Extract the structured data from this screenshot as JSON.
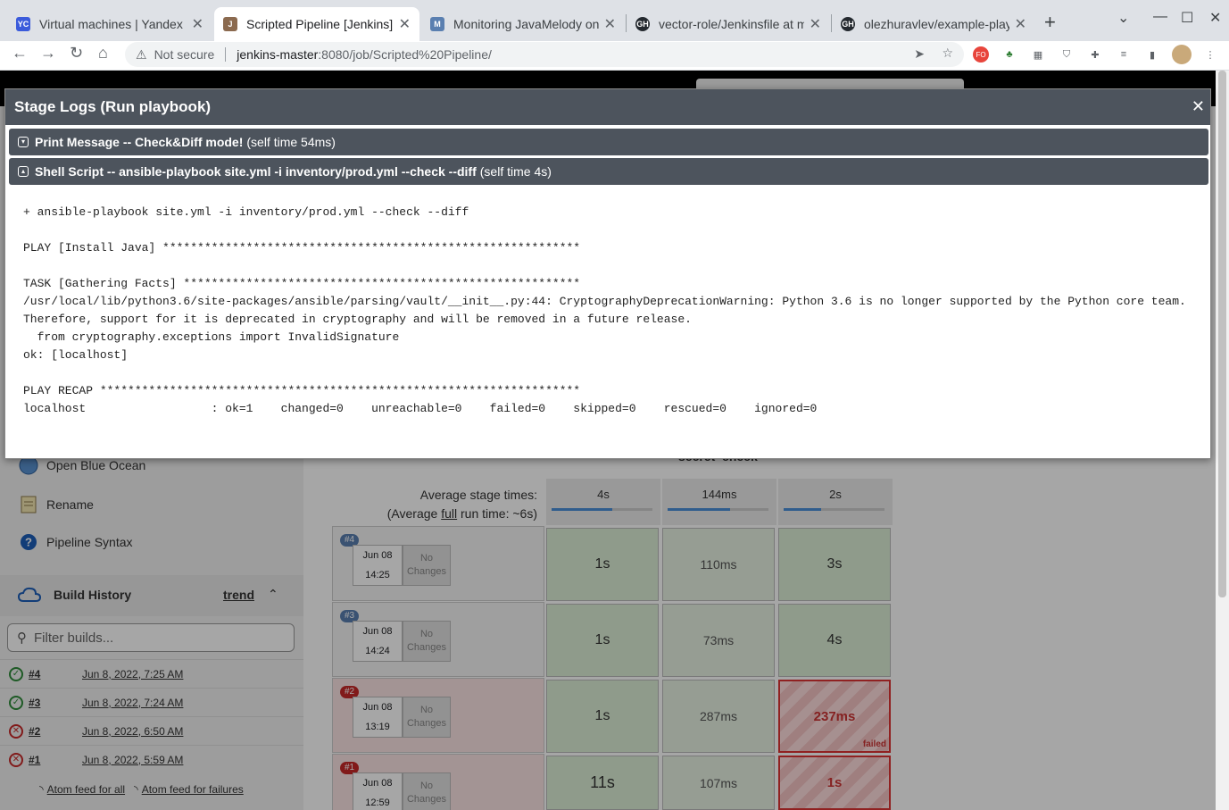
{
  "browser": {
    "tabs": [
      {
        "title": "Virtual machines | Yandex Cl",
        "favicon": "YC",
        "color": "#3b5bdb",
        "active": false
      },
      {
        "title": "Scripted Pipeline [Jenkins]",
        "favicon": "J",
        "color": "#8b6a4f",
        "active": true
      },
      {
        "title": "Monitoring JavaMelody on _je",
        "favicon": "M",
        "color": "#5a7fb0",
        "active": false
      },
      {
        "title": "vector-role/Jenkinsfile at ma",
        "favicon": "GH",
        "color": "#24292f",
        "active": false
      },
      {
        "title": "olezhuravlev/example-playb",
        "favicon": "GH",
        "color": "#24292f",
        "active": false
      }
    ],
    "url_security": "Not secure",
    "url_host": "jenkins-master",
    "url_path": ":8080/job/Scripted%20Pipeline/"
  },
  "modal": {
    "title": "Stage Logs (Run playbook)",
    "close_label": "✕",
    "sections": [
      {
        "label": "Print Message -- Check&Diff mode!",
        "time": "(self time 54ms)"
      },
      {
        "label": "Shell Script -- ansible-playbook site.yml -i inventory/prod.yml --check --diff",
        "time": "(self time 4s)"
      }
    ],
    "console": "+ ansible-playbook site.yml -i inventory/prod.yml --check --diff\n\nPLAY [Install Java] ************************************************************\n\nTASK [Gathering Facts] *********************************************************\n/usr/local/lib/python3.6/site-packages/ansible/parsing/vault/__init__.py:44: CryptographyDeprecationWarning: Python 3.6 is no longer supported by the Python core team.\nTherefore, support for it is deprecated in cryptography and will be removed in a future release.\n  from cryptography.exceptions import InvalidSignature\nok: [localhost]\n\nPLAY RECAP *********************************************************************\nlocalhost                  : ok=1    changed=0    unreachable=0    failed=0    skipped=0    rescued=0    ignored=0"
  },
  "sidebar": {
    "items": [
      {
        "label": "Open Blue Ocean",
        "icon": "blue-ocean-icon"
      },
      {
        "label": "Rename",
        "icon": "notepad-icon"
      },
      {
        "label": "Pipeline Syntax",
        "icon": "help-icon"
      }
    ],
    "build_history_title": "Build History",
    "trend_label": "trend",
    "filter_placeholder": "Filter builds...",
    "builds": [
      {
        "num": "#4",
        "date": "Jun 8, 2022, 7:25 AM",
        "status": "success"
      },
      {
        "num": "#3",
        "date": "Jun 8, 2022, 7:24 AM",
        "status": "success"
      },
      {
        "num": "#2",
        "date": "Jun 8, 2022, 6:50 AM",
        "status": "failure"
      },
      {
        "num": "#1",
        "date": "Jun 8, 2022, 5:59 AM",
        "status": "failure"
      }
    ],
    "feed_all": "Atom feed for all",
    "feed_failures": "Atom feed for failures"
  },
  "stage_view": {
    "partial_header": "secret_check",
    "avg_label_line1": "Average stage times:",
    "avg_label_line2_pre": "(Average ",
    "avg_label_line2_link": "full",
    "avg_label_line2_post": " run time: ~6s)",
    "avg_times": [
      {
        "value": "4s",
        "bar_fraction": 0.6
      },
      {
        "value": "144ms",
        "bar_fraction": 0.62
      },
      {
        "value": "2s",
        "bar_fraction": 0.37
      }
    ],
    "runs": [
      {
        "badge": "#4",
        "date": "Jun 08",
        "time": "14:25",
        "changes": "No Changes",
        "status": "success",
        "stages": [
          "1s",
          "110ms",
          "3s"
        ],
        "failed_stage": false
      },
      {
        "badge": "#3",
        "date": "Jun 08",
        "time": "14:24",
        "changes": "No Changes",
        "status": "success",
        "stages": [
          "1s",
          "73ms",
          "4s"
        ],
        "failed_stage": false
      },
      {
        "badge": "#2",
        "date": "Jun 08",
        "time": "13:19",
        "changes": "No Changes",
        "status": "failure",
        "stages": [
          "1s",
          "287ms",
          "237ms"
        ],
        "failed_stage": true,
        "failed_label": "failed"
      },
      {
        "badge": "#1",
        "date": "Jun 08",
        "time": "12:59",
        "changes": "No Changes",
        "status": "failure",
        "stages": [
          "11s",
          "107ms",
          "1s"
        ],
        "failed_stage": true
      }
    ]
  }
}
